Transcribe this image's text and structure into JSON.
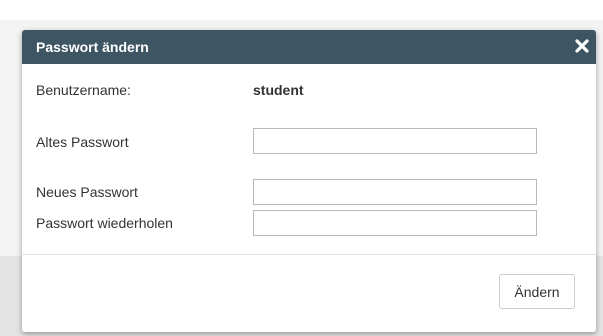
{
  "dialog": {
    "title": "Passwort ändern",
    "close_icon": "close-icon",
    "username_label": "Benutzername:",
    "username_value": "student",
    "old_password_label": "Altes Passwort",
    "old_password_value": "",
    "new_password_label": "Neues Passwort",
    "new_password_value": "",
    "repeat_password_label": "Passwort wiederholen",
    "repeat_password_value": "",
    "submit_label": "Ändern"
  },
  "colors": {
    "titlebar": "#3e5563",
    "title_text": "#ffffff"
  }
}
